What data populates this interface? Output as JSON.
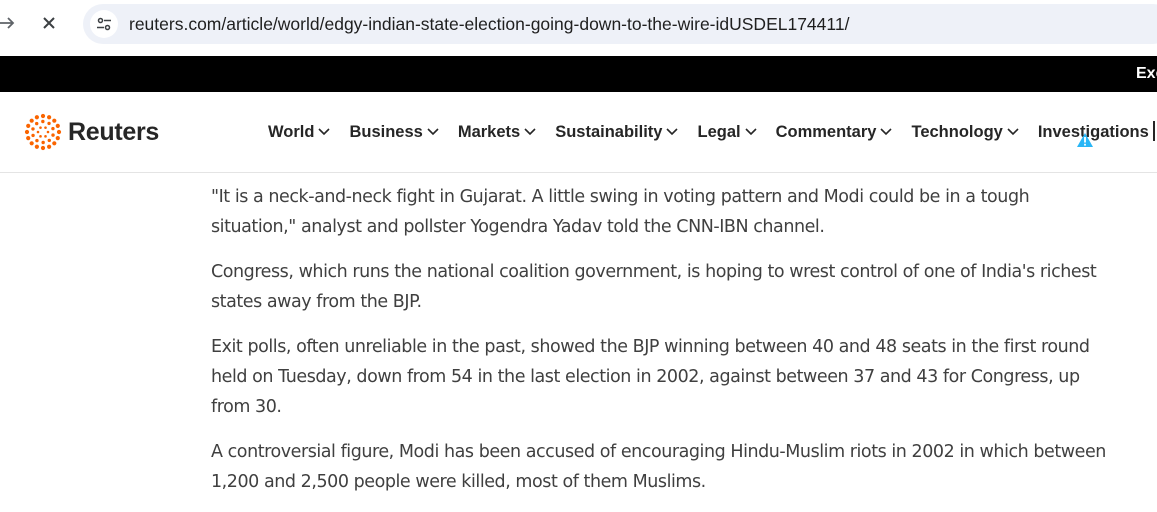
{
  "browser": {
    "url": "reuters.com/article/world/edgy-indian-state-election-going-down-to-the-wire-idUSDEL174411/",
    "forward_icon": "arrow-right-icon",
    "stop_icon": "close-icon",
    "site_info_icon": "tune-icon"
  },
  "promo": {
    "text": "Exc"
  },
  "header": {
    "logo_text": "Reuters",
    "nav": [
      {
        "label": "World"
      },
      {
        "label": "Business"
      },
      {
        "label": "Markets"
      },
      {
        "label": "Sustainability"
      },
      {
        "label": "Legal"
      },
      {
        "label": "Commentary"
      },
      {
        "label": "Technology"
      },
      {
        "label": "Investigations"
      }
    ]
  },
  "article": {
    "paragraphs": [
      "\"It is a neck-and-neck fight in Gujarat. A little swing in voting pattern and Modi could be in a tough situation,\" analyst and pollster Yogendra Yadav told the CNN-IBN channel.",
      "Congress, which runs the national coalition government, is hoping to wrest control of one of India's richest states away from the BJP.",
      "Exit polls, often unreliable in the past, showed the BJP winning between 40 and 48 seats in the first round held on Tuesday, down from 54 in the last election in 2002, against between 37 and 43 for Congress, up from 30.",
      "A controversial figure, Modi has been accused of encouraging Hindu-Muslim riots in 2002 in which between 1,200 and 2,500 people were killed, most of them Muslims."
    ]
  },
  "colors": {
    "brand_orange": "#fa6400",
    "promo_bg": "#000000",
    "omnibox_bg": "#eef1f8",
    "warning": "#29b6f6"
  }
}
